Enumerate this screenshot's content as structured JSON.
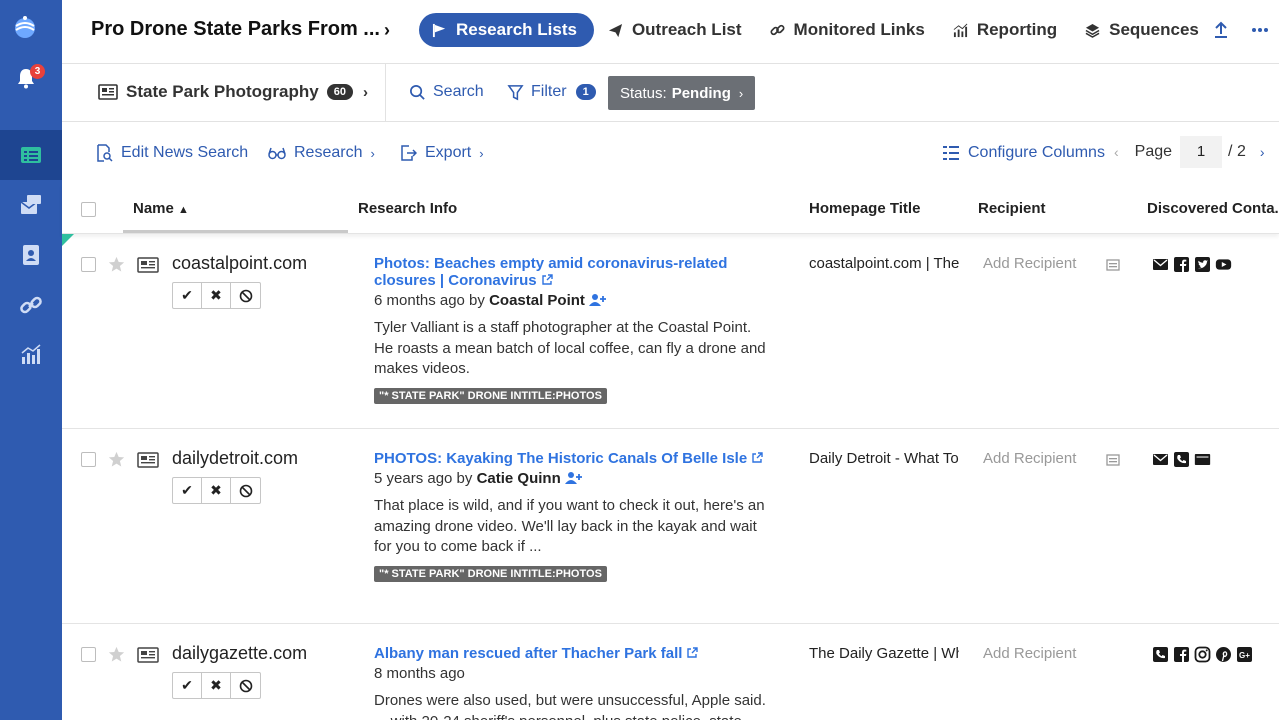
{
  "sidebar": {
    "notification_count": "3",
    "nav_items": [
      "research-lists",
      "outreach",
      "contacts",
      "links",
      "reporting"
    ]
  },
  "header": {
    "project_title": "Pro Drone State Parks From ...",
    "tabs": [
      {
        "label": "Research Lists",
        "active": true
      },
      {
        "label": "Outreach List",
        "active": false
      },
      {
        "label": "Monitored Links",
        "active": false
      },
      {
        "label": "Reporting",
        "active": false
      },
      {
        "label": "Sequences",
        "active": false
      }
    ]
  },
  "listbar": {
    "list_name": "State Park Photography",
    "list_count": "60",
    "search_label": "Search",
    "filter_label": "Filter",
    "filter_count": "1",
    "status_prefix": "Status:",
    "status_value": "Pending"
  },
  "toolbar": {
    "edit_search": "Edit News Search",
    "research": "Research",
    "export": "Export",
    "configure_columns": "Configure Columns",
    "page_label": "Page",
    "page_current": "1",
    "page_total": "/ 2"
  },
  "table": {
    "columns": [
      "Name",
      "Research Info",
      "Homepage Title",
      "Recipient",
      "Discovered Conta..."
    ],
    "rows": [
      {
        "domain": "coastalpoint.com",
        "title": "Photos: Beaches empty amid coronavirus-related closures | Coronavirus",
        "age": "6 months ago by",
        "author": "Coastal Point",
        "snippet": "Tyler Valliant is a staff photographer at the Coastal Point. He roasts a mean batch of local coffee, can fly a drone and makes videos.",
        "tag": "\"* STATE PARK\" DRONE INTITLE:PHOTOS",
        "homepage_title": "coastalpoint.com | The",
        "recipient": "Add Recipient",
        "contacts": [
          "email-icon",
          "facebook-icon",
          "twitter-icon",
          "youtube-icon"
        ]
      },
      {
        "domain": "dailydetroit.com",
        "title": "PHOTOS: Kayaking The Historic Canals Of Belle Isle",
        "age": "5 years ago by",
        "author": "Catie Quinn",
        "snippet": "That place is wild, and if you want to check it out, here's an amazing drone video. We'll lay back in the kayak and wait for you to come back if ...",
        "tag": "\"* STATE PARK\" DRONE INTITLE:PHOTOS",
        "homepage_title": "Daily Detroit - What To",
        "recipient": "Add Recipient",
        "contacts": [
          "email-icon",
          "phone-icon",
          "contact-form-icon"
        ]
      },
      {
        "domain": "dailygazette.com",
        "title": "Albany man rescued after Thacher Park fall",
        "age": "8 months ago",
        "author": "",
        "snippet": "Drones were also used, but were unsuccessful, Apple said. ... with 20-24 sheriff's personnel, plus state police, state park",
        "tag": "",
        "homepage_title": "The Daily Gazette | Wh",
        "recipient": "Add Recipient",
        "contacts": [
          "phone-icon",
          "facebook-icon",
          "instagram-icon",
          "pinterest-icon",
          "googleplus-icon"
        ]
      }
    ]
  },
  "colors": {
    "brand_blue": "#2f5bb0",
    "link_blue": "#2f73e0",
    "status_grey": "#6b6f75"
  }
}
